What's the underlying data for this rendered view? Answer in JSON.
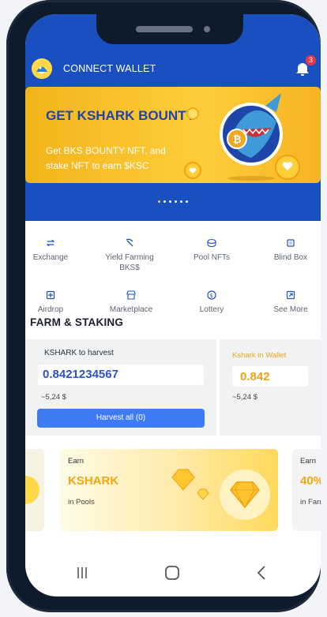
{
  "header": {
    "connect_label": "CONNECT WALLET",
    "notification_count": "3"
  },
  "banner": {
    "title": "GET KSHARK BOUNTY",
    "subtitle": "Get BKS BOUNTY NFT, and stake NFT to earn $KSC",
    "dots_total": 6,
    "active_dot": 0
  },
  "menu": {
    "items": [
      {
        "label": "Exchange",
        "icon": "swap-icon"
      },
      {
        "label": "Yield Farming BKS$",
        "icon": "pickaxe-icon"
      },
      {
        "label": "Pool NFTs",
        "icon": "coin-stack-icon"
      },
      {
        "label": "Blind Box",
        "icon": "box-icon"
      },
      {
        "label": "Airdrop",
        "icon": "gift-icon"
      },
      {
        "label": "Marketplace",
        "icon": "store-icon"
      },
      {
        "label": "Lottery",
        "icon": "dollar-coin-icon"
      },
      {
        "label": "See More",
        "icon": "external-icon"
      }
    ]
  },
  "farm": {
    "title": "FARM & STAKING",
    "harvest": {
      "label": "KSHARK to harvest",
      "value": "0.8421234567",
      "usd": "~5,24 $",
      "button": "Harvest all (0)"
    },
    "wallet": {
      "label": "Kshark in Wallet",
      "value": "0.842",
      "usd": "~5,24 $"
    }
  },
  "earn_cards": [
    {
      "earn": "Earn",
      "big": "KSHARK",
      "sub": "in Pools"
    },
    {
      "earn": "Earn",
      "big": "40%",
      "sub": "in Farms"
    }
  ],
  "colors": {
    "primary": "#1a4fc0",
    "accent": "#ffc830",
    "button": "#3e7bf2"
  }
}
